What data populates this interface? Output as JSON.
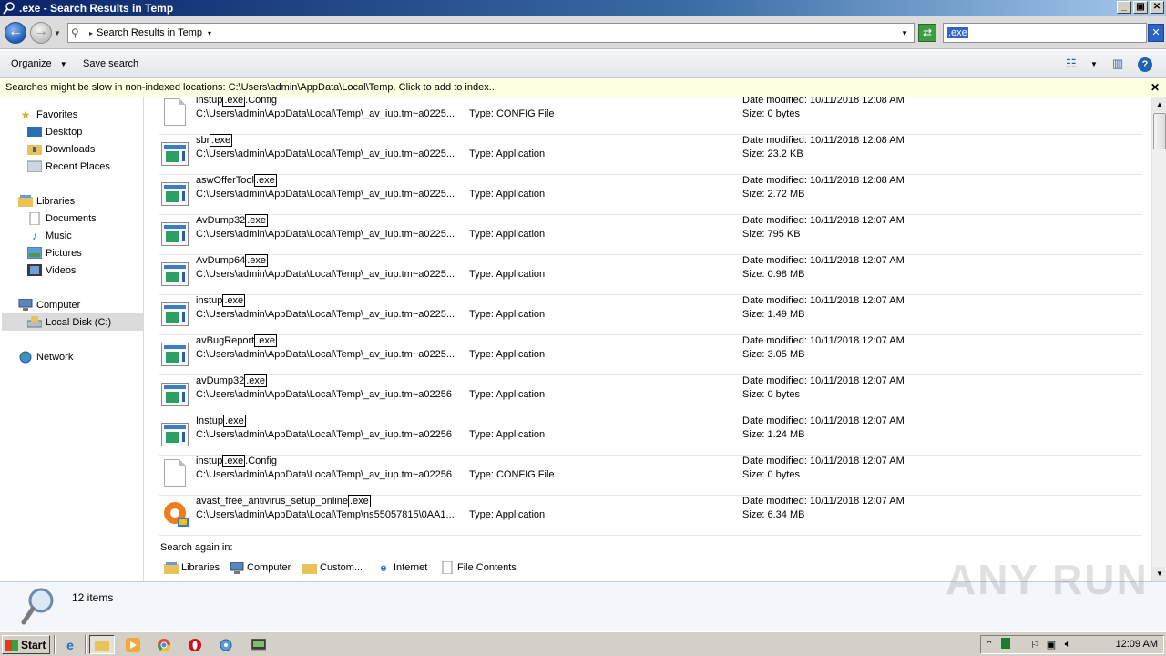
{
  "window": {
    "title": ".exe - Search Results in Temp",
    "controls": {
      "minimize": "_",
      "maximize": "▣",
      "close": "✕"
    }
  },
  "address": {
    "breadcrumb": "Search Results in Temp",
    "search_value": ".exe"
  },
  "toolbar": {
    "organize_label": "Organize",
    "save_search_label": "Save search"
  },
  "infobar": {
    "text": "Searches might be slow in non-indexed locations: C:\\Users\\admin\\AppData\\Local\\Temp. Click to add to index..."
  },
  "nav": {
    "favorites": "Favorites",
    "desktop": "Desktop",
    "downloads": "Downloads",
    "recent_places": "Recent Places",
    "libraries": "Libraries",
    "documents": "Documents",
    "music": "Music",
    "pictures": "Pictures",
    "videos": "Videos",
    "computer": "Computer",
    "local_disk": "Local Disk (C:)",
    "network": "Network"
  },
  "results": [
    {
      "name_pre": "instup",
      "name_hl": ".exe",
      "name_post": ".Config",
      "path": "C:\\Users\\admin\\AppData\\Local\\Temp\\_av_iup.tm~a0225...",
      "type": "Type: CONFIG File",
      "date": "Date modified: 10/11/2018 12:08 AM",
      "size": "Size: 0 bytes",
      "icon": "document-icon"
    },
    {
      "name_pre": "sbr",
      "name_hl": ".exe",
      "name_post": "",
      "path": "C:\\Users\\admin\\AppData\\Local\\Temp\\_av_iup.tm~a0225...",
      "type": "Type: Application",
      "date": "Date modified: 10/11/2018 12:08 AM",
      "size": "Size: 23.2 KB",
      "icon": "application-icon"
    },
    {
      "name_pre": "aswOfferTool",
      "name_hl": ".exe",
      "name_post": "",
      "path": "C:\\Users\\admin\\AppData\\Local\\Temp\\_av_iup.tm~a0225...",
      "type": "Type: Application",
      "date": "Date modified: 10/11/2018 12:08 AM",
      "size": "Size: 2.72 MB",
      "icon": "application-icon"
    },
    {
      "name_pre": "AvDump32",
      "name_hl": ".exe",
      "name_post": "",
      "path": "C:\\Users\\admin\\AppData\\Local\\Temp\\_av_iup.tm~a0225...",
      "type": "Type: Application",
      "date": "Date modified: 10/11/2018 12:07 AM",
      "size": "Size: 795 KB",
      "icon": "application-icon"
    },
    {
      "name_pre": "AvDump64",
      "name_hl": ".exe",
      "name_post": "",
      "path": "C:\\Users\\admin\\AppData\\Local\\Temp\\_av_iup.tm~a0225...",
      "type": "Type: Application",
      "date": "Date modified: 10/11/2018 12:07 AM",
      "size": "Size: 0.98 MB",
      "icon": "application-icon"
    },
    {
      "name_pre": "instup",
      "name_hl": ".exe",
      "name_post": "",
      "path": "C:\\Users\\admin\\AppData\\Local\\Temp\\_av_iup.tm~a0225...",
      "type": "Type: Application",
      "date": "Date modified: 10/11/2018 12:07 AM",
      "size": "Size: 1.49 MB",
      "icon": "application-icon"
    },
    {
      "name_pre": "avBugReport",
      "name_hl": ".exe",
      "name_post": "",
      "path": "C:\\Users\\admin\\AppData\\Local\\Temp\\_av_iup.tm~a0225...",
      "type": "Type: Application",
      "date": "Date modified: 10/11/2018 12:07 AM",
      "size": "Size: 3.05 MB",
      "icon": "application-icon"
    },
    {
      "name_pre": "avDump32",
      "name_hl": ".exe",
      "name_post": "",
      "path": "C:\\Users\\admin\\AppData\\Local\\Temp\\_av_iup.tm~a02256",
      "type": "Type: Application",
      "date": "Date modified: 10/11/2018 12:07 AM",
      "size": "Size: 0 bytes",
      "icon": "application-icon"
    },
    {
      "name_pre": "Instup",
      "name_hl": ".exe",
      "name_post": "",
      "path": "C:\\Users\\admin\\AppData\\Local\\Temp\\_av_iup.tm~a02256",
      "type": "Type: Application",
      "date": "Date modified: 10/11/2018 12:07 AM",
      "size": "Size: 1.24 MB",
      "icon": "application-icon"
    },
    {
      "name_pre": "instup",
      "name_hl": ".exe",
      "name_post": ".Config",
      "path": "C:\\Users\\admin\\AppData\\Local\\Temp\\_av_iup.tm~a02256",
      "type": "Type: CONFIG File",
      "date": "Date modified: 10/11/2018 12:07 AM",
      "size": "Size: 0 bytes",
      "icon": "document-icon"
    },
    {
      "name_pre": "avast_free_antivirus_setup_online",
      "name_hl": ".exe",
      "name_post": "",
      "path": "C:\\Users\\admin\\AppData\\Local\\Temp\\ns55057815\\0AA1...",
      "type": "Type: Application",
      "date": "Date modified: 10/11/2018 12:07 AM",
      "size": "Size: 6.34 MB",
      "icon": "avast-icon"
    }
  ],
  "search_again": {
    "label": "Search again in:",
    "libraries": "Libraries",
    "computer": "Computer",
    "custom": "Custom...",
    "internet": "Internet",
    "file_contents": "File Contents"
  },
  "details": {
    "count": "12 items",
    "watermark": "ANY RUN"
  },
  "taskbar": {
    "start_label": "Start",
    "clock": "12:09 AM"
  }
}
